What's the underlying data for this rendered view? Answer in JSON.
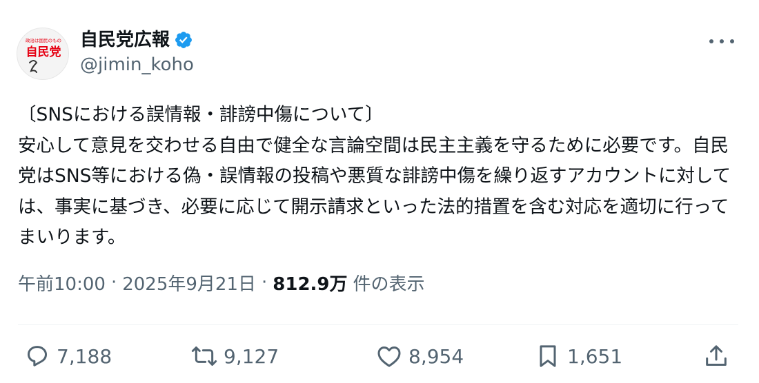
{
  "account": {
    "display_name": "自民党広報",
    "handle": "@jimin_koho",
    "verified": true,
    "avatar": {
      "top_text": "政治は国民のもの",
      "logo_text": "自民党",
      "accent_color": "#e60012"
    }
  },
  "tweet": {
    "text": "〔SNSにおける誤情報・誹謗中傷について〕\n安心して意見を交わせる自由で健全な言論空間は民主主義を守るために必要です。自民党はSNS等における偽・誤情報の投稿や悪質な誹謗中傷を繰り返すアカウントに対しては、事実に基づき、必要に応じて開示請求といった法的措置を含む対応を適切に行ってまいります。"
  },
  "meta": {
    "time": "午前10:00",
    "date": "2025年9月21日",
    "separator": "·",
    "views_count": "812.9万",
    "views_label": "件の表示"
  },
  "actions": {
    "replies": "7,188",
    "reposts": "9,127",
    "likes": "8,954",
    "bookmarks": "1,651"
  },
  "icons": {
    "verified": "verified-badge-icon",
    "more": "more-options-icon",
    "reply": "reply-icon",
    "repost": "repost-icon",
    "like": "heart-icon",
    "bookmark": "bookmark-icon",
    "share": "share-icon"
  },
  "colors": {
    "verified_blue": "#1d9bf0",
    "text_primary": "#0f1419",
    "text_secondary": "#536471"
  }
}
